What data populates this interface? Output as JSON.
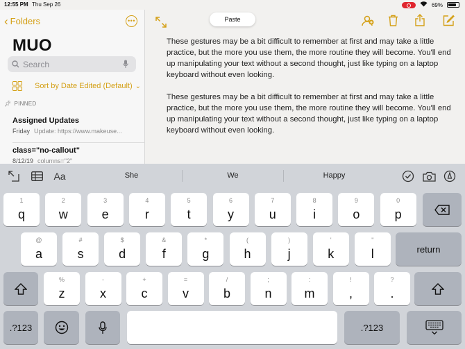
{
  "status": {
    "time": "12:55 PM",
    "date": "Thu Sep 26",
    "battery": "69%"
  },
  "sidebar": {
    "back_label": "Folders",
    "folder_title": "MUO",
    "search_placeholder": "Search",
    "sort_label": "Sort by Date Edited (Default)",
    "pinned_label": "PINNED",
    "notes": [
      {
        "title": "Assigned Updates",
        "date": "Friday",
        "preview": "Update: https://www.makeuse..."
      },
      {
        "title": "class=\"no-callout\"",
        "date": "8/12/19",
        "preview": "columns=\"2\""
      }
    ]
  },
  "editor": {
    "paste_label": "Paste",
    "paragraphs": [
      "These gestures may be a bit difficult to remember at first and may take a little practice, but the more you use them, the more routine they will become. You'll end up manipulating your text without a second thought, just like typing on a laptop keyboard without even looking.",
      "These gestures may be a bit difficult to remember at first and may take a little practice, but the more you use them, the more routine they will become. You'll end up manipulating your text without a second thought, just like typing on a laptop keyboard without even looking."
    ]
  },
  "keyboard": {
    "format_label": "Aa",
    "predictions": [
      "She",
      "We",
      "Happy"
    ],
    "row1": [
      {
        "sec": "1",
        "pri": "q"
      },
      {
        "sec": "2",
        "pri": "w"
      },
      {
        "sec": "3",
        "pri": "e"
      },
      {
        "sec": "4",
        "pri": "r"
      },
      {
        "sec": "5",
        "pri": "t"
      },
      {
        "sec": "6",
        "pri": "y"
      },
      {
        "sec": "7",
        "pri": "u"
      },
      {
        "sec": "8",
        "pri": "i"
      },
      {
        "sec": "9",
        "pri": "o"
      },
      {
        "sec": "0",
        "pri": "p"
      }
    ],
    "row2": [
      {
        "sec": "@",
        "pri": "a"
      },
      {
        "sec": "#",
        "pri": "s"
      },
      {
        "sec": "$",
        "pri": "d"
      },
      {
        "sec": "&",
        "pri": "f"
      },
      {
        "sec": "*",
        "pri": "g"
      },
      {
        "sec": "(",
        "pri": "h"
      },
      {
        "sec": ")",
        "pri": "j"
      },
      {
        "sec": "'",
        "pri": "k"
      },
      {
        "sec": "\"",
        "pri": "l"
      }
    ],
    "row3": [
      {
        "sec": "%",
        "pri": "z"
      },
      {
        "sec": "-",
        "pri": "x"
      },
      {
        "sec": "+",
        "pri": "c"
      },
      {
        "sec": "=",
        "pri": "v"
      },
      {
        "sec": "/",
        "pri": "b"
      },
      {
        "sec": ";",
        "pri": "n"
      },
      {
        "sec": ":",
        "pri": "m"
      },
      {
        "sec": "!",
        "pri": ","
      },
      {
        "sec": "?",
        "pri": "."
      }
    ],
    "return_label": "return",
    "numbers_label": ".?123"
  },
  "colors": {
    "accent": "#d4a017",
    "record": "#e0262e"
  }
}
